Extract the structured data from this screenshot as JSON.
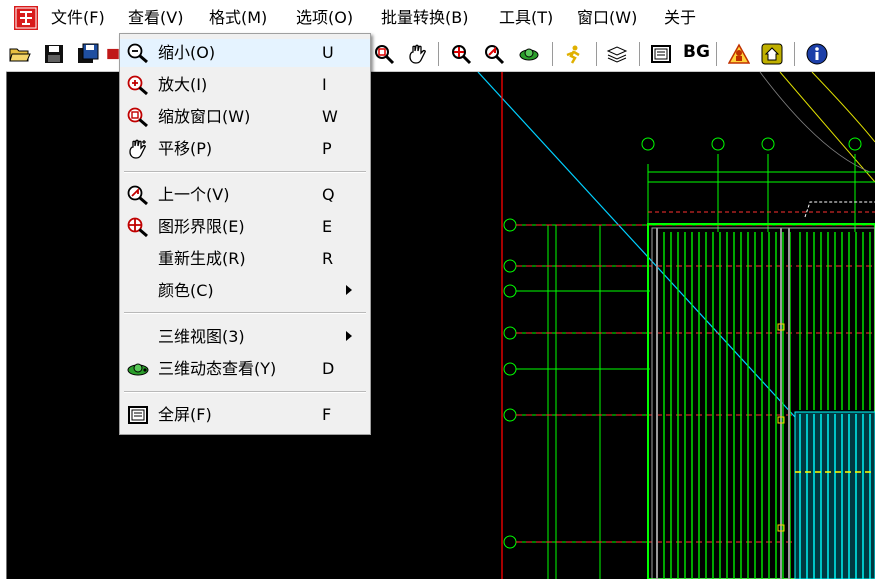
{
  "menubar": {
    "items": [
      "文件(F)",
      "查看(V)",
      "格式(M)",
      "选项(O)",
      "批量转换(B)",
      "工具(T)",
      "窗口(W)",
      "关于"
    ]
  },
  "toolbar": {
    "bg_label": "BG"
  },
  "view_menu": {
    "items": [
      {
        "label": "缩小(O)",
        "key": "U",
        "icon": "zoom-out-icon"
      },
      {
        "label": "放大(I)",
        "key": "I",
        "icon": "zoom-in-icon"
      },
      {
        "label": "缩放窗口(W)",
        "key": "W",
        "icon": "zoom-window-icon"
      },
      {
        "label": "平移(P)",
        "key": "P",
        "icon": "pan-hand-icon"
      },
      {
        "label": "上一个(V)",
        "key": "Q",
        "icon": "zoom-previous-icon"
      },
      {
        "label": "图形界限(E)",
        "key": "E",
        "icon": "zoom-extents-icon"
      },
      {
        "label": "重新生成(R)",
        "key": "R",
        "icon": ""
      },
      {
        "label": "颜色(C)",
        "key": "",
        "icon": "",
        "submenu": true
      },
      {
        "label": "三维视图(3)",
        "key": "",
        "icon": "",
        "submenu": true
      },
      {
        "label": "三维动态查看(Y)",
        "key": "D",
        "icon": "3d-orbit-icon"
      },
      {
        "label": "全屏(F)",
        "key": "F",
        "icon": "fullscreen-icon"
      }
    ]
  },
  "colors": {
    "drawing_background": "#000000",
    "grid_green": "#00ff00",
    "wall_cyan": "#00ffff",
    "axis_red": "#ff0000",
    "menu_background": "#f0f0f0"
  }
}
